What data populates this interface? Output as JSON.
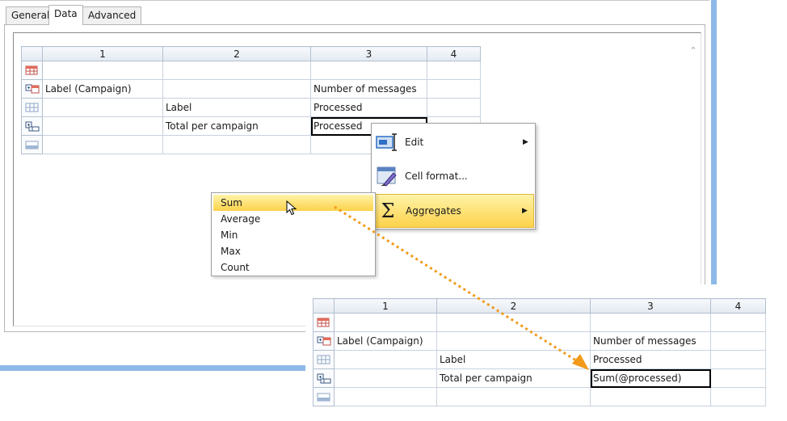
{
  "tabs": [
    {
      "label": "General",
      "active": false
    },
    {
      "label": "Data",
      "active": true
    },
    {
      "label": "Advanced",
      "active": false
    }
  ],
  "grid_top": {
    "columns": [
      "1",
      "2",
      "3",
      "4"
    ],
    "rows": [
      {
        "icon": "header-row-icon",
        "cells": [
          "",
          "",
          "",
          ""
        ]
      },
      {
        "icon": "expand-label-row-icon",
        "cells": [
          "Label (Campaign)",
          "",
          "Number of messages",
          ""
        ]
      },
      {
        "icon": "data-row-icon",
        "cells": [
          "",
          "Label",
          "Processed",
          ""
        ]
      },
      {
        "icon": "total-row-icon",
        "cells": [
          "",
          "Total per campaign",
          "Processed",
          ""
        ]
      },
      {
        "icon": "footer-row-icon",
        "cells": [
          "",
          "",
          "",
          ""
        ]
      }
    ]
  },
  "context_menu": {
    "items": [
      {
        "label": "Edit",
        "icon": "edit-icon",
        "has_submenu": true
      },
      {
        "label": "Cell format...",
        "icon": "cell-format-icon",
        "has_submenu": false
      },
      {
        "label": "Aggregates",
        "icon": "sigma-icon",
        "has_submenu": true,
        "highlighted": true
      }
    ]
  },
  "aggregates_submenu": {
    "items": [
      {
        "label": "Sum",
        "highlighted": true
      },
      {
        "label": "Average"
      },
      {
        "label": "Min"
      },
      {
        "label": "Max"
      },
      {
        "label": "Count"
      }
    ]
  },
  "grid_bottom": {
    "columns": [
      "1",
      "2",
      "3",
      "4"
    ],
    "rows": [
      {
        "icon": "header-row-icon",
        "cells": [
          "",
          "",
          "",
          ""
        ]
      },
      {
        "icon": "expand-label-row-icon",
        "cells": [
          "Label (Campaign)",
          "",
          "Number of messages",
          ""
        ]
      },
      {
        "icon": "data-row-icon",
        "cells": [
          "",
          "Label",
          "Processed",
          ""
        ]
      },
      {
        "icon": "total-row-icon",
        "cells": [
          "",
          "Total per campaign",
          "Sum(@processed)",
          ""
        ]
      },
      {
        "icon": "footer-row-icon",
        "cells": [
          "",
          "",
          "",
          ""
        ]
      }
    ]
  },
  "colors": {
    "highlight": "#fcd24a",
    "arrow": "#f29a1a",
    "window_accent": "#8db9e8"
  }
}
